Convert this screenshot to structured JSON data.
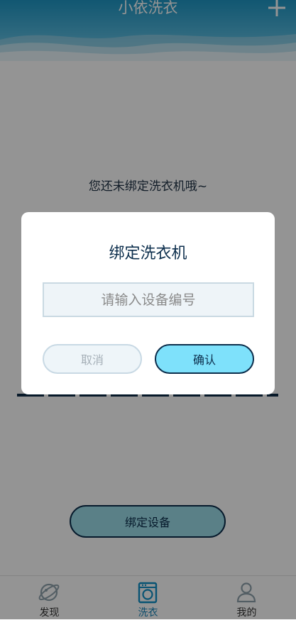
{
  "header": {
    "title": "小依洗衣",
    "add_icon": "plus-icon"
  },
  "main": {
    "empty_message": "您还未绑定洗衣机哦~",
    "bind_button": "绑定设备"
  },
  "tabs": [
    {
      "label": "发现",
      "icon": "discover-planet-icon",
      "active": false
    },
    {
      "label": "洗衣",
      "icon": "washing-machine-icon",
      "active": true
    },
    {
      "label": "我的",
      "icon": "user-icon",
      "active": false
    }
  ],
  "dialog": {
    "title": "绑定洗衣机",
    "input_placeholder": "请输入设备编号",
    "input_value": "",
    "cancel_label": "取消",
    "confirm_label": "确认"
  },
  "colors": {
    "accent": "#1a86b8",
    "dark": "#0c2e4c",
    "confirm": "#7ee1fb",
    "button": "#9cdde8"
  }
}
